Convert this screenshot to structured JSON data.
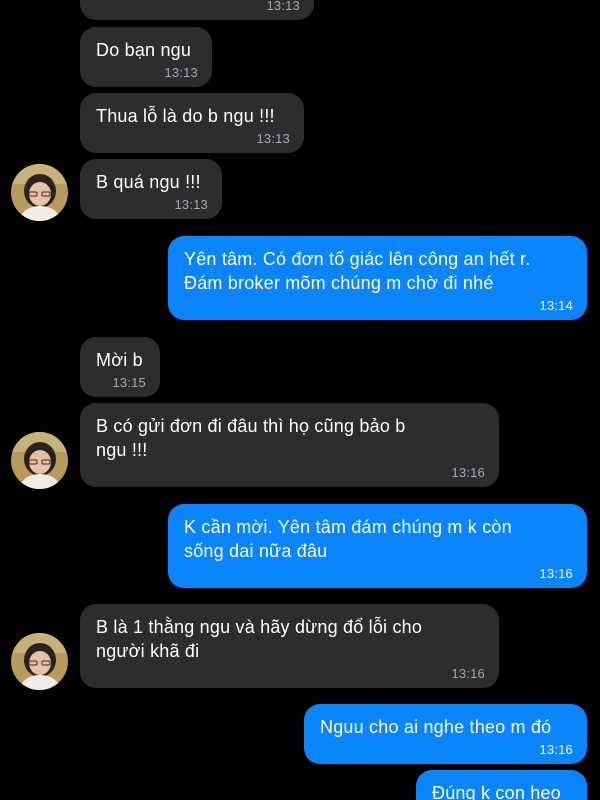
{
  "messages": [
    {
      "side": "in",
      "text": "",
      "time": "13:13"
    },
    {
      "side": "in",
      "text": "Do bạn ngu",
      "time": "13:13"
    },
    {
      "side": "in",
      "text": "Thua lỗ là do b ngu !!!",
      "time": "13:13"
    },
    {
      "side": "in",
      "text": "B quá ngu !!!",
      "time": "13:13"
    },
    {
      "side": "out",
      "text": "Yên tâm. Có đơn tố giác lên công an hết r.\nĐám broker mõm chúng m chờ đi nhé",
      "time": "13:14"
    },
    {
      "side": "in",
      "text": "Mời b",
      "time": "13:15"
    },
    {
      "side": "in",
      "text": "B có gửi đơn đi đâu thì họ cũng bảo b\nngu !!!",
      "time": "13:16"
    },
    {
      "side": "out",
      "text": "K cần mời. Yên tâm đám chúng m k còn\nsống dai nữa đâu",
      "time": "13:16"
    },
    {
      "side": "in",
      "text": "B là 1 thằng ngu và hãy dừng đổ lỗi cho\nngười khã đi",
      "time": "13:16"
    },
    {
      "side": "out",
      "text": "Nguu cho ai nghe theo m đó",
      "time": "13:16"
    },
    {
      "side": "out",
      "text": "Đúng k con heo",
      "time": ""
    }
  ],
  "avatar_icon": "contact-avatar-photo",
  "colors": {
    "background": "#000000",
    "incoming_bubble": "#2d2d2f",
    "outgoing_bubble": "#0b84ff",
    "incoming_time": "#a8a8ad",
    "outgoing_time": "#ffffff"
  }
}
